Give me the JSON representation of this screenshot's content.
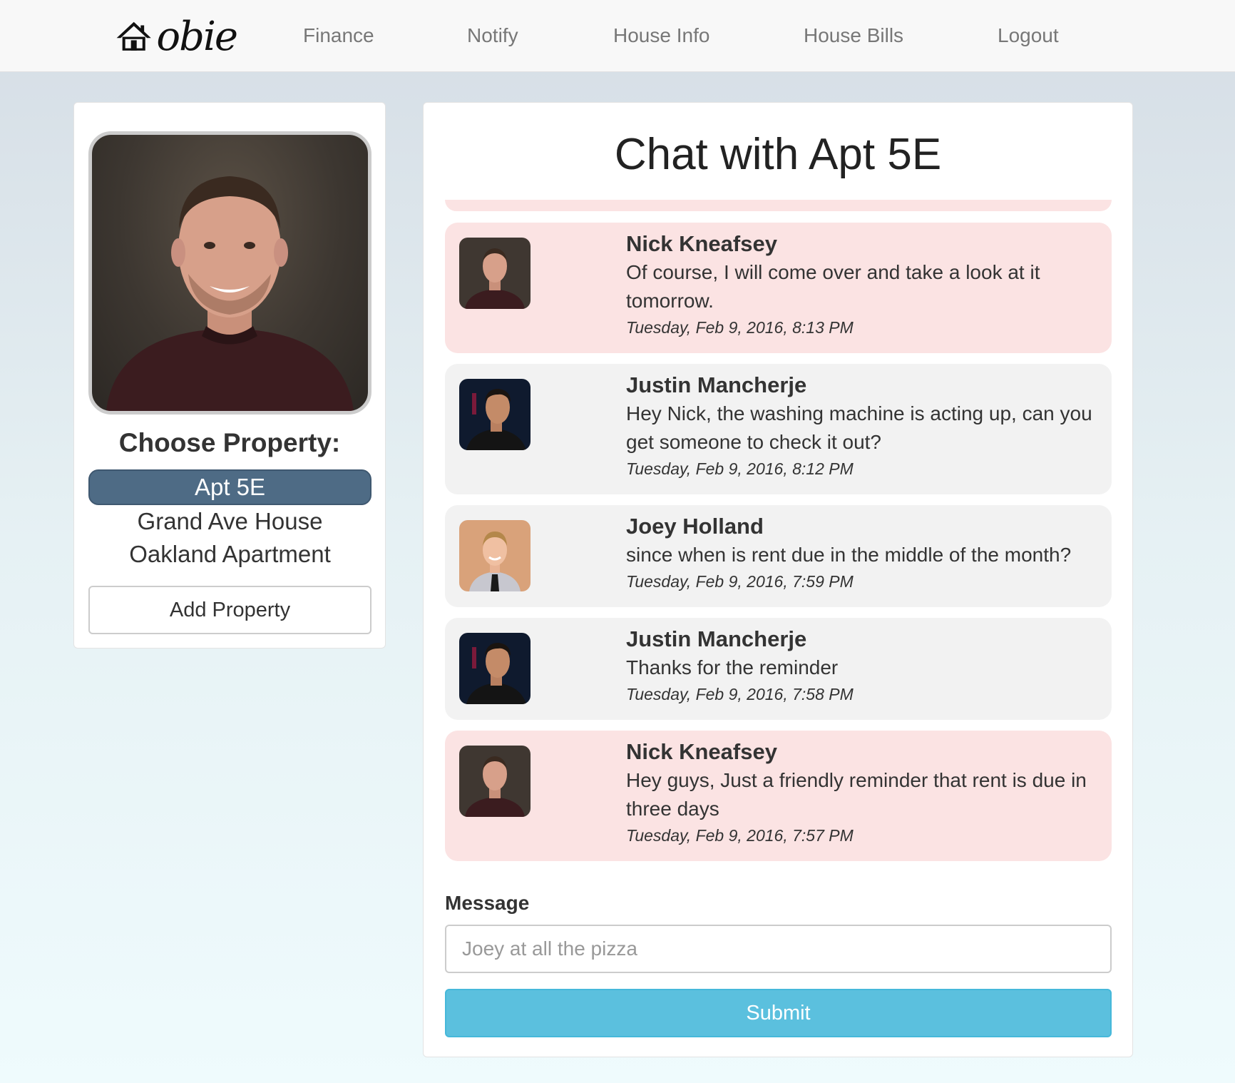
{
  "nav": {
    "brand": "obie",
    "links": [
      "Finance",
      "Notify",
      "House Info",
      "House Bills",
      "Logout"
    ]
  },
  "sidebar": {
    "choose_label": "Choose Property:",
    "properties": [
      {
        "label": "Apt 5E",
        "active": true
      },
      {
        "label": "Grand Ave House",
        "active": false
      },
      {
        "label": "Oakland Apartment",
        "active": false
      }
    ],
    "add_button": "Add Property"
  },
  "chat": {
    "title": "Chat with Apt 5E",
    "messages": [
      {
        "name": "Nick Kneafsey",
        "text": "Of course, I will come over and take a look at it tomorrow.",
        "time": "Tuesday, Feb 9, 2016, 8:13 PM",
        "style": "pink",
        "avatar": "nick"
      },
      {
        "name": "Justin Mancherje",
        "text": "Hey Nick, the washing machine is acting up, can you get someone to check it out?",
        "time": "Tuesday, Feb 9, 2016, 8:12 PM",
        "style": "gray",
        "avatar": "justin"
      },
      {
        "name": "Joey Holland",
        "text": "since when is rent due in the middle of the month?",
        "time": "Tuesday, Feb 9, 2016, 7:59 PM",
        "style": "gray",
        "avatar": "joey"
      },
      {
        "name": "Justin Mancherje",
        "text": "Thanks for the reminder",
        "time": "Tuesday, Feb 9, 2016, 7:58 PM",
        "style": "gray",
        "avatar": "justin"
      },
      {
        "name": "Nick Kneafsey",
        "text": "Hey guys, Just a friendly reminder that rent is due in three days",
        "time": "Tuesday, Feb 9, 2016, 7:57 PM",
        "style": "pink",
        "avatar": "nick"
      }
    ],
    "form": {
      "label": "Message",
      "input_placeholder": "Joey at all the pizza",
      "submit": "Submit"
    }
  },
  "colors": {
    "active_property": "#4e6b85",
    "submit": "#5bc0de",
    "own_message": "#fbe3e3",
    "other_message": "#f2f2f2"
  }
}
